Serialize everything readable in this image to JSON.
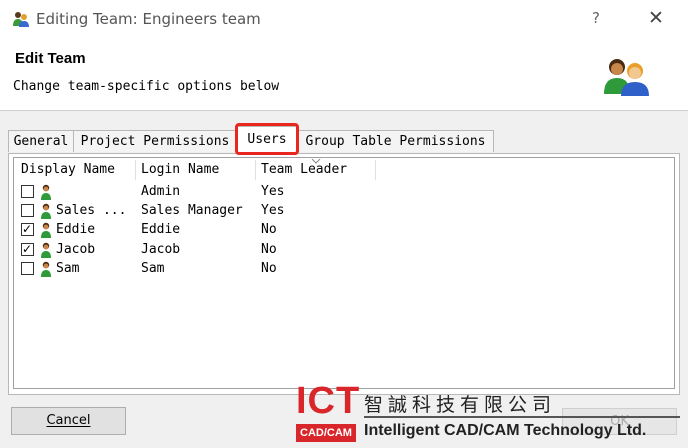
{
  "window": {
    "title": "Editing Team: Engineers team",
    "help_glyph": "?",
    "close_glyph": "✕",
    "icon": "team-icon"
  },
  "header": {
    "heading": "Edit Team",
    "subtitle": "Change team-specific options below",
    "icon": "team-large-icon"
  },
  "tabs": [
    "General",
    "Project Permissions",
    "Users",
    "Group Table Permissions"
  ],
  "active_tab": "Users",
  "list": {
    "columns": [
      "Display Name",
      "Login Name",
      "Team Leader"
    ],
    "rows": [
      {
        "checked": false,
        "display_name": "",
        "login_name": "Admin",
        "team_leader": "Yes"
      },
      {
        "checked": false,
        "display_name": "Sales ...",
        "login_name": "Sales Manager",
        "team_leader": "Yes"
      },
      {
        "checked": true,
        "display_name": "Eddie",
        "login_name": "Eddie",
        "team_leader": "No"
      },
      {
        "checked": true,
        "display_name": "Jacob",
        "login_name": "Jacob",
        "team_leader": "No"
      },
      {
        "checked": false,
        "display_name": "Sam",
        "login_name": "Sam",
        "team_leader": "No"
      }
    ]
  },
  "buttons": {
    "cancel": "Cancel",
    "ok": "OK"
  },
  "watermark": {
    "logo": "ICT",
    "badge": "CAD/CAM",
    "chinese": "智誠科技有限公司",
    "english": "Intelligent CAD/CAM Technology Ltd."
  },
  "colors": {
    "highlight": "#e8281e",
    "watermark_red": "#d9262a"
  }
}
